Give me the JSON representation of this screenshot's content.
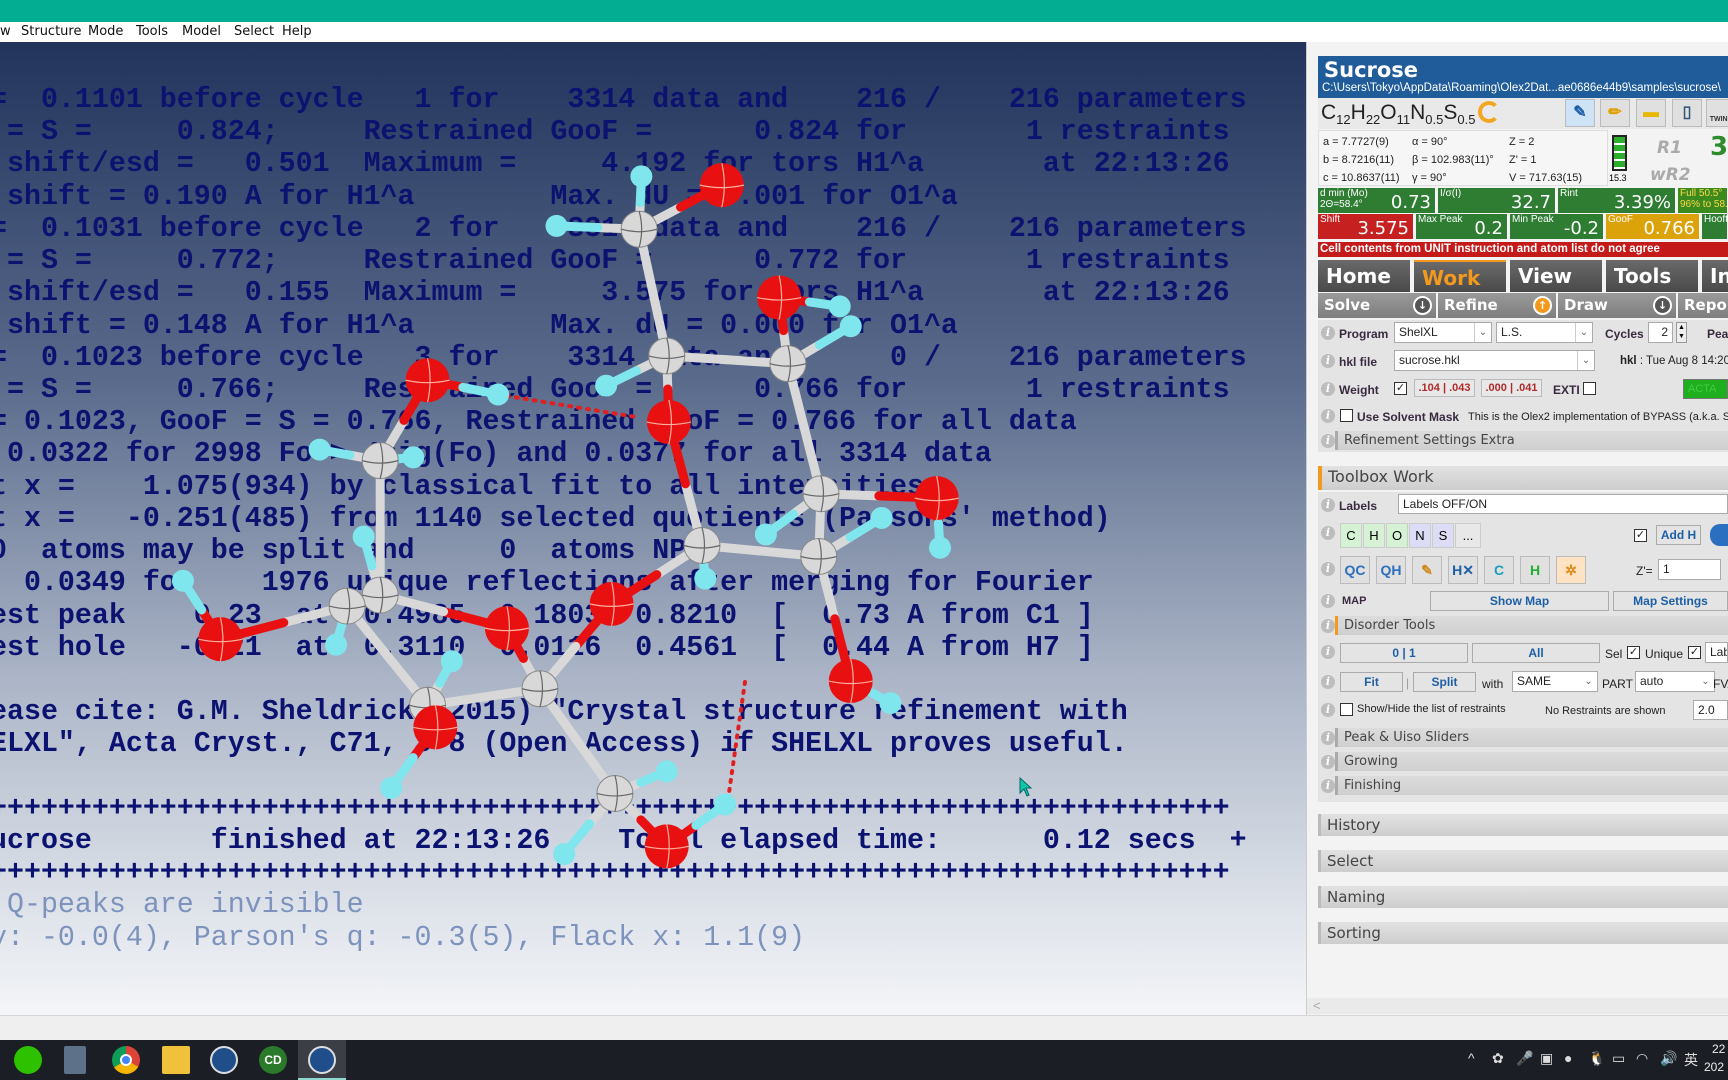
{
  "menu": [
    "w",
    "Structure",
    "Mode",
    "Tools",
    "Model",
    "Select",
    "Help"
  ],
  "console": {
    "lines": [
      "=  0.1101 before cycle   1 for    3314 data and    216 /    216 parameters",
      " = S =     0.824;     Restrained GooF =      0.824 for       1 restraints",
      " shift/esd =   0.501  Maximum =     4.192 for tors H1^a       at 22:13:26",
      " shift = 0.190 A for H1^a        Max. dU = 0.001 for O1^a",
      "=  0.1031 before cycle   2 for    3314 data and    216 /    216 parameters",
      " = S =     0.772;     Restrained GooF =      0.772 for       1 restraints",
      " shift/esd =   0.155  Maximum =     3.575 for tors H1^a       at 22:13:26",
      " shift = 0.148 A for H1^a        Max. dU = 0.000 for O1^a",
      "=  0.1023 before cycle   3 for    3314 data and      0 /    216 parameters",
      " = S =     0.766;     Restrained GooF =      0.766 for       1 restraints",
      "= 0.1023, GooF = S = 0.766, Restrained GooF = 0.766 for all data",
      " 0.0322 for 2998 Fo > 4sig(Fo) and 0.0377 for all 3314 data",
      "t x =    1.075(934) by classical fit to all intensities",
      "t x =   -0.251(485) from 1140 selected quotients (Parsons' method)",
      "0  atoms may be split and     0  atoms NPD",
      "  0.0349 for    1976 unique reflections after merging for Fourier",
      "est peak    0.23  at  0.4985  0.1803  0.8210  [  0.73 A from C1 ]",
      "est hole   -0.21  at  0.3110  0.0116  0.4561  [  0.44 A from H7 ]",
      "",
      "ease cite: G.M. Sheldrick (2015) \"Crystal structure refinement with",
      "ELXL\", Acta Cryst., C71, 3-8 (Open Access) if SHELXL proves useful.",
      "",
      "+++++++++++++++++++++++++++++++++++++++++++++++++++++++++++++++++++++++++",
      "ucrose       finished at 22:13:26    Total elapsed time:      0.12 secs  +",
      "+++++++++++++++++++++++++++++++++++++++++++++++++++++++++++++++++++++++++"
    ],
    "notes": [
      " Q-peaks are invisible",
      "y: -0.0(4), Parson's q: -0.3(5), Flack x: 1.1(9)"
    ],
    "atom_colors": {
      "C": "#d8d8d8",
      "O": "#e81010",
      "H": "#7fe6ee"
    }
  },
  "panel": {
    "title": "Sucrose",
    "path": "C:\\Users\\Tokyo\\AppData\\Roaming\\Olex2Dat...ae0686e44b9\\samples\\sucrose\\",
    "formula": [
      {
        "el": "C",
        "n": "12"
      },
      {
        "el": "H",
        "n": "22"
      },
      {
        "el": "O",
        "n": "11"
      },
      {
        "el": "N",
        "n": "0.5"
      },
      {
        "el": "S",
        "n": "0.5"
      }
    ],
    "toolbar_icons": [
      "refresh-icon",
      "edit-structure-icon",
      "pencil-icon",
      "folder-icon",
      "notebook-icon",
      "twins-icon"
    ],
    "twins_label": "TWINS",
    "cell": [
      [
        "a = 7.7727(9)",
        "α = 90°",
        "Z = 2"
      ],
      [
        "b = 8.7216(11)",
        "β = 102.983(11)°",
        "Z' = 1"
      ],
      [
        "c = 10.8637(11)",
        "γ = 90°",
        "V = 717.63(15)"
      ]
    ],
    "battery": "15.3",
    "r1": "R1",
    "wr2": "wR2",
    "r1_value": "3",
    "stats1": [
      {
        "k": "d min (Mo)\n2Θ=58.4°",
        "v": "0.73",
        "color": "#2e7d32"
      },
      {
        "k": "I/σ(I)",
        "v": "32.7",
        "color": "#2e7d32"
      },
      {
        "k": "Rint",
        "v": "3.39%",
        "color": "#2e7d32"
      },
      {
        "k": "Full 50.5°\n96% to 58.",
        "v": "",
        "color": "#3b8a1e"
      }
    ],
    "stats2": [
      {
        "k": "Shift",
        "v": "3.575",
        "color": "#c62020"
      },
      {
        "k": "Max Peak",
        "v": "0.2",
        "color": "#2e7d32"
      },
      {
        "k": "Min Peak",
        "v": "-0.2",
        "color": "#2e7d32"
      },
      {
        "k": "GooF",
        "v": "0.766",
        "color": "#dba20a"
      },
      {
        "k": "Hooft",
        "v": "",
        "color": "#2e7d32"
      }
    ],
    "warning": "Cell contents from UNIT instruction and atom list do not agree",
    "tabs": [
      "Home",
      "Work",
      "View",
      "Tools",
      "In"
    ],
    "active_tab": "Work",
    "subtabs": [
      "Solve",
      "Refine",
      "Draw",
      "Report"
    ],
    "program_label": "Program",
    "program": "ShelXL",
    "method": "L.S.",
    "cycles_label": "Cycles",
    "cycles": "2",
    "peaks_label": "Pea",
    "hkl_label": "hkl file",
    "hkl": "sucrose.hkl",
    "hkl_info_key": "hkl",
    "hkl_info": " : Tue Aug 8 14:20",
    "weight_label": "Weight",
    "weight_checked": true,
    "weight1": ".104 | .043",
    "weight2": ".000 | .041",
    "exti_label": "EXTI",
    "exti_checked": false,
    "acta": "ACTA",
    "solvent_label": "Use Solvent Mask",
    "solvent_checked": false,
    "solvent_desc": "This is the Olex2 implementation of BYPASS (a.k.a. SQUEEZE)",
    "refinement_extra": "Refinement Settings Extra",
    "toolbox_title": "Toolbox Work",
    "labels_label": "Labels",
    "labels_value": "Labels OFF/ON",
    "elements": [
      "C",
      "H",
      "O",
      "N",
      "S",
      "..."
    ],
    "addh_checked": true,
    "addh": "Add H",
    "tool_icons": [
      "q-to-c-icon",
      "q-to-h-icon",
      "clean-icon",
      "delete-h-icon",
      "refresh-c-icon",
      "hfix-icon",
      "shrink-icon"
    ],
    "tool_icon_glyphs": [
      "QC",
      "QH",
      "✎",
      "H✕",
      "C",
      "H",
      "✲"
    ],
    "zprime_label": "Z'=",
    "zprime": "1",
    "map_label": "MAP",
    "show_map": "Show Map",
    "map_settings": "Map Settings",
    "disorder": "Disorder Tools",
    "part01": "0 | 1",
    "all": "All",
    "sel_label": "Sel",
    "unique_label": "Unique",
    "labels_short": "Labe",
    "fit": "Fit",
    "sep": "|",
    "split": "Split",
    "with_label": "with",
    "with_value": "SAME",
    "part_label": "PART",
    "part_value": "auto",
    "fvar_label": "FVAR",
    "restraints_label": "Show/Hide the list of restraints",
    "restraints_status": "No Restraints are shown",
    "restraints_value": "2.0",
    "sliders": "Peak & Uiso Sliders",
    "growing": "Growing",
    "finishing": "Finishing",
    "sections": [
      "History",
      "Select",
      "Naming",
      "Sorting"
    ],
    "scroll_left": "<"
  },
  "taskbar": {
    "apps": [
      "wechat-icon",
      "calculator-icon",
      "chrome-icon",
      "file-explorer-icon",
      "olex2-icon",
      "chemdraw-icon",
      "olex2-active-icon"
    ],
    "cd_label": "CD",
    "tray": [
      "^",
      "✿",
      "🎤",
      "▣",
      "●",
      "🐧",
      "▭",
      "◠",
      "🔊",
      "英"
    ],
    "clock_time": "22",
    "clock_date": "202"
  }
}
